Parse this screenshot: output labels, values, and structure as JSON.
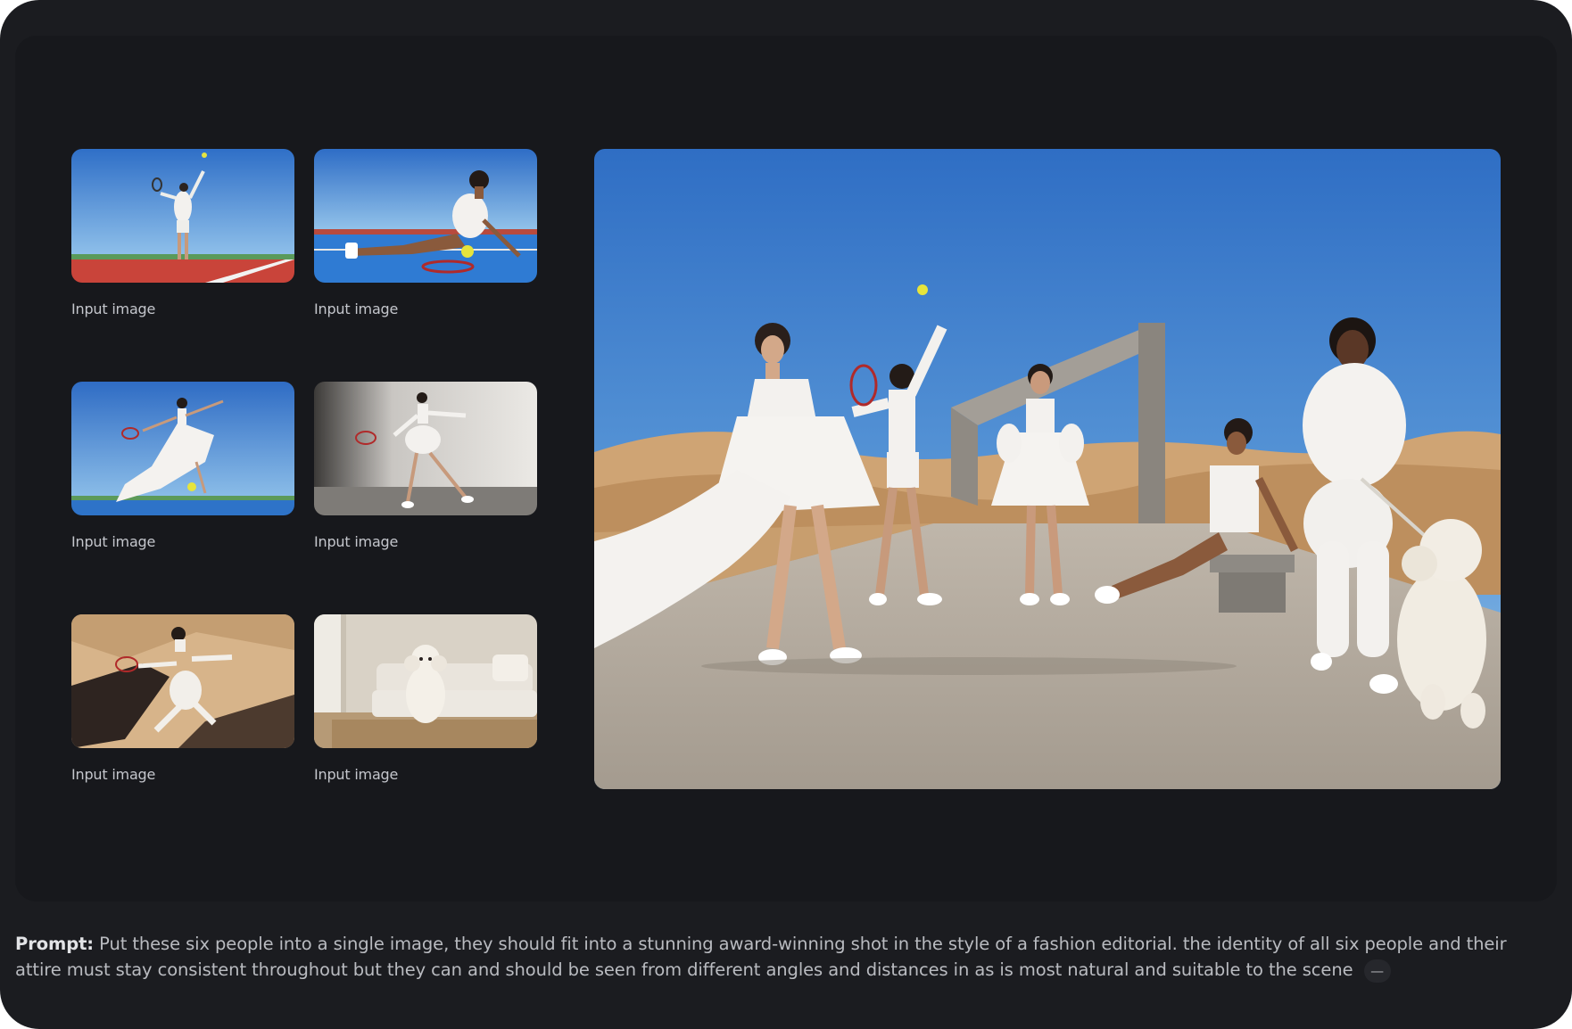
{
  "input_images": [
    {
      "caption": "Input image",
      "icon": "tennis-serve-photo"
    },
    {
      "caption": "Input image",
      "icon": "tennis-seated-photo"
    },
    {
      "caption": "Input image",
      "icon": "tennis-dress-leap-photo"
    },
    {
      "caption": "Input image",
      "icon": "studio-tennis-photo"
    },
    {
      "caption": "Input image",
      "icon": "desert-dune-photo"
    },
    {
      "caption": "Input image",
      "icon": "poodle-living-room-photo"
    }
  ],
  "output_image": {
    "icon": "desert-fashion-editorial-photo"
  },
  "prompt": {
    "label": "Prompt:",
    "text": "Put these six people into a single image, they should fit into a stunning award-winning shot in the style of a fashion editorial. the identity of all six people and their attire must stay consistent throughout but they can and should be seen from different angles and distances in as is most natural and suitable to the scene",
    "expand_symbol": "—"
  },
  "colors": {
    "frame_bg": "#1b1c20",
    "panel_bg": "#17181c",
    "caption_text": "#c4c6cc",
    "prompt_text": "#b9bbc0"
  }
}
